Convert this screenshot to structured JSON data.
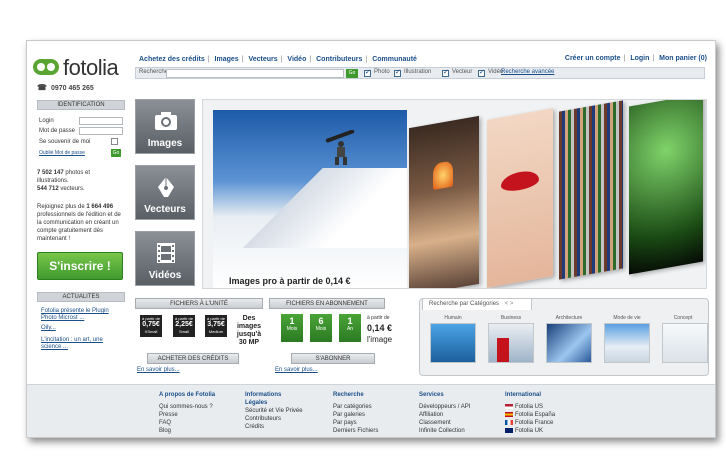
{
  "brand": {
    "name": "fotolia",
    "phone": "0970 465 265"
  },
  "topnav": {
    "items": [
      "Achetez des crédits",
      "Images",
      "Vecteurs",
      "Vidéo",
      "Contributeurs",
      "Communauté"
    ]
  },
  "topright": {
    "create_account": "Créer un compte",
    "login": "Login",
    "cart": "Mon panier (0)"
  },
  "search": {
    "label": "Recherche",
    "placeholder": "",
    "go": "Go",
    "filters": [
      "Photo",
      "Illustration",
      "Vecteur",
      "Vidéo"
    ],
    "advanced": "Recherche avancée"
  },
  "login": {
    "header": "IDENTIFICATION",
    "login_label": "Login",
    "password_label": "Mot de passe",
    "remember": "Se souvenir de moi",
    "forgot": "Oublié Mot de passe",
    "ok": "Go"
  },
  "stats": {
    "photos_count": "7 502 147",
    "photos_text": "photos et illustrations.",
    "vectors_count": "544 712",
    "vectors_text": "vecteurs."
  },
  "join": {
    "pre": "Rejoignez plus de",
    "count": "1 664 496",
    "text": "professionnels de l'édition et de la communication en créant un compte gratuitement dès maintenant !"
  },
  "signup": "S'inscrire !",
  "news": {
    "header": "ACTUALITES",
    "items": [
      "Fotolia présente le Plugin Photo Microst ...",
      "Oily...",
      "L'incitation : un art, une science ..."
    ]
  },
  "categories": [
    {
      "label": "Images",
      "icon": "camera-icon"
    },
    {
      "label": "Vecteurs",
      "icon": "pen-nib-icon"
    },
    {
      "label": "Vidéos",
      "icon": "film-icon"
    }
  ],
  "hero": {
    "caption": "Images pro à partir de 0,14 €"
  },
  "unit": {
    "header": "FICHIERS À L'UNITÉ",
    "prices": [
      {
        "top": "à partir de",
        "price": "0,75€",
        "size": "XSmall"
      },
      {
        "top": "à partir de",
        "price": "2,25€",
        "size": "Small"
      },
      {
        "top": "à partir de",
        "price": "3,75€",
        "size": "Medium"
      }
    ],
    "note": "Des images jusqu'à 30 MP",
    "buy": "ACHETER DES CRÉDITS",
    "more": "En savoir plus..."
  },
  "subscription": {
    "header": "FICHIERS EN ABONNEMENT",
    "plans": [
      {
        "n": "1",
        "unit": "Mois"
      },
      {
        "n": "6",
        "unit": "Mois"
      },
      {
        "n": "1",
        "unit": "An"
      }
    ],
    "from": "à partir de",
    "price": "0,14 €",
    "per": "l'image",
    "subscribe": "S'ABONNER",
    "more": "En savoir plus..."
  },
  "catsearch": {
    "title": "Recherche par Catégories",
    "arrows": "< >",
    "items": [
      "Humain",
      "Business",
      "Architecture",
      "Mode de vie",
      "Concept"
    ]
  },
  "footer": {
    "cols": [
      {
        "head": "A propos de Fotolia",
        "items": [
          "Qui sommes-nous ?",
          "Presse",
          "FAQ",
          "Blog"
        ]
      },
      {
        "head": "Informations Légales",
        "items": [
          "Sécurité et Vie Privée",
          "Contributeurs",
          "Crédits"
        ]
      },
      {
        "head": "Recherche",
        "items": [
          "Par catégories",
          "Par galeries",
          "Par pays",
          "Derniers Fichiers"
        ]
      },
      {
        "head": "Services",
        "items": [
          "Développeurs / API",
          "Affiliation",
          "Classement",
          "Infinite Collection"
        ]
      },
      {
        "head": "International",
        "items": [
          "Fotolia US",
          "Fotolia España",
          "Fotolia France",
          "Fotolia UK"
        ]
      }
    ]
  },
  "colors": {
    "accent": "#1b4f8a",
    "green": "#3f9a2d"
  }
}
